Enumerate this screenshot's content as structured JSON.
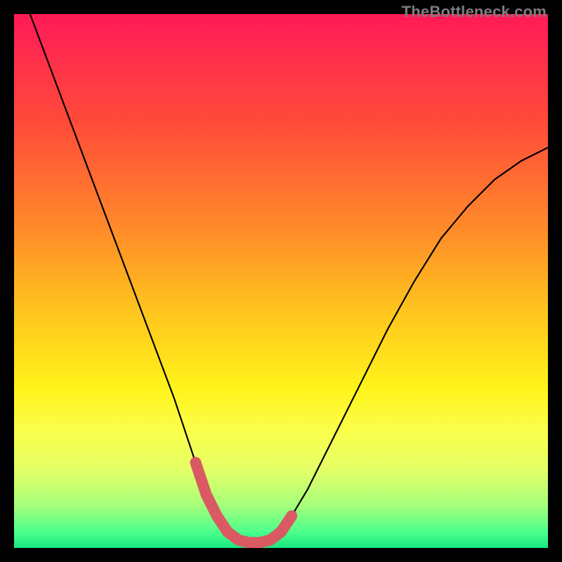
{
  "watermark": "TheBottleneck.com",
  "chart_data": {
    "type": "line",
    "title": "",
    "xlabel": "",
    "ylabel": "",
    "xlim": [
      0,
      100
    ],
    "ylim": [
      0,
      100
    ],
    "gradient_stops": [
      {
        "offset": 0.0,
        "color": "#ff1a57"
      },
      {
        "offset": 0.2,
        "color": "#ff4a3a"
      },
      {
        "offset": 0.4,
        "color": "#ff8a2a"
      },
      {
        "offset": 0.55,
        "color": "#ffc21e"
      },
      {
        "offset": 0.7,
        "color": "#fff31a"
      },
      {
        "offset": 0.78,
        "color": "#faff4a"
      },
      {
        "offset": 0.85,
        "color": "#e6ff66"
      },
      {
        "offset": 0.92,
        "color": "#a6ff7a"
      },
      {
        "offset": 0.97,
        "color": "#4cff8c"
      },
      {
        "offset": 1.0,
        "color": "#17e880"
      }
    ],
    "series": [
      {
        "name": "bottleneck-curve",
        "x": [
          3,
          6,
          9,
          12,
          15,
          18,
          21,
          24,
          27,
          30,
          32,
          34,
          36,
          38,
          40,
          42,
          44,
          46,
          48,
          50,
          52,
          55,
          58,
          62,
          66,
          70,
          75,
          80,
          85,
          90,
          95,
          100
        ],
        "y": [
          100,
          92,
          84,
          76,
          68,
          60,
          52,
          44,
          36,
          28,
          22,
          16,
          10,
          6,
          3,
          1.5,
          1,
          1,
          1.5,
          3,
          6,
          11,
          17,
          25,
          33,
          41,
          50,
          58,
          64,
          69,
          72.5,
          75
        ]
      }
    ],
    "highlight": {
      "name": "sweet-spot",
      "color": "#d95a63",
      "stroke_width": 16,
      "dots_radius": 6,
      "x": [
        34,
        36,
        38,
        40,
        42,
        44,
        46,
        48,
        50,
        52
      ],
      "y": [
        16,
        10,
        6,
        3,
        1.5,
        1,
        1,
        1.5,
        3,
        6
      ]
    }
  }
}
